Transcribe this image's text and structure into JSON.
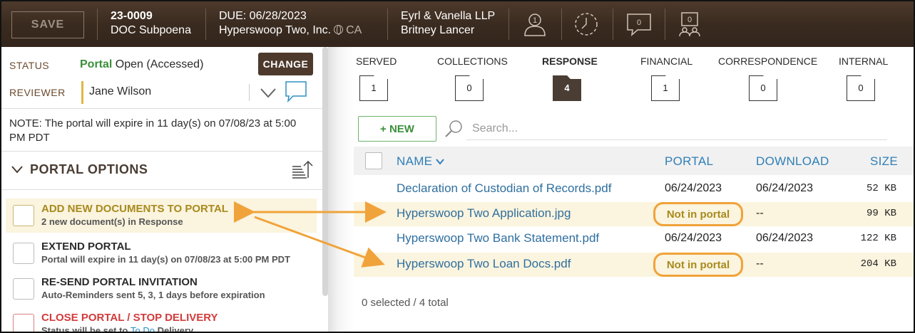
{
  "header": {
    "save_label": "SAVE",
    "case_number": "23-0009",
    "case_type": "DOC Subpoena",
    "due_label": "DUE: 06/28/2023",
    "party": "Hyperswoop Two, Inc.",
    "state": "CA",
    "firm": "Eyrl & Vanella LLP",
    "contact": "Britney Lancer",
    "icons": [
      {
        "name": "person-icon",
        "count": "1"
      },
      {
        "name": "clock-icon",
        "count": ""
      },
      {
        "name": "message-icon",
        "count": "0"
      },
      {
        "name": "people-icon",
        "count": "0"
      }
    ]
  },
  "left": {
    "status_label": "STATUS",
    "status_portal": "Portal",
    "status_text": "Open (Accessed)",
    "change_label": "CHANGE",
    "reviewer_label": "REVIEWER",
    "reviewer_value": "Jane Wilson",
    "note": "NOTE: The portal will expire in 11 day(s) on 07/08/23 at 5:00 PM PDT",
    "portal_options_title": "PORTAL OPTIONS",
    "options": [
      {
        "title": "ADD NEW DOCUMENTS TO PORTAL",
        "sub": "2 new document(s) in Response",
        "title_color": "#a88a1e",
        "highlight": true
      },
      {
        "title": "EXTEND PORTAL",
        "sub": "Portal will expire in 11 day(s) on 07/08/23 at 5:00 PM PDT",
        "title_color": "#2b2b2b",
        "highlight": false
      },
      {
        "title": "RE-SEND PORTAL INVITATION",
        "sub": "Auto-Reminders sent 5, 3, 1 days before expiration",
        "title_color": "#2b2b2b",
        "highlight": false
      },
      {
        "title": "CLOSE PORTAL / STOP DELIVERY",
        "sub_prefix": "Status will be set to",
        "sub_link": "To Do",
        "sub_suffix": "Delivery",
        "title_color": "#d23b3b",
        "highlight": false
      }
    ]
  },
  "tabs": [
    {
      "label": "SERVED",
      "count": "1",
      "active": false
    },
    {
      "label": "COLLECTIONS",
      "count": "0",
      "active": false
    },
    {
      "label": "RESPONSE",
      "count": "4",
      "active": true
    },
    {
      "label": "FINANCIAL",
      "count": "1",
      "active": false
    },
    {
      "label": "CORRESPONDENCE",
      "count": "0",
      "active": false
    },
    {
      "label": "INTERNAL",
      "count": "0",
      "active": false
    }
  ],
  "toolbar": {
    "new_label": "+ NEW",
    "search_placeholder": "Search..."
  },
  "table": {
    "columns": {
      "name": "NAME",
      "portal": "PORTAL",
      "download": "DOWNLOAD",
      "size": "SIZE"
    },
    "rows": [
      {
        "name": "Declaration of Custodian of Records.pdf",
        "portal": "06/24/2023",
        "download": "06/24/2023",
        "size": "52 KB",
        "not_in_portal": false
      },
      {
        "name": "Hyperswoop Two Application.jpg",
        "portal": "Not in portal",
        "download": "--",
        "size": "99 KB",
        "not_in_portal": true
      },
      {
        "name": "Hyperswoop Two Bank Statement.pdf",
        "portal": "06/24/2023",
        "download": "06/24/2023",
        "size": "122 KB",
        "not_in_portal": false
      },
      {
        "name": "Hyperswoop Two Loan Docs.pdf",
        "portal": "Not in portal",
        "download": "--",
        "size": "204 KB",
        "not_in_portal": true
      }
    ],
    "footer": "0 selected / 4 total"
  },
  "colors": {
    "header_bg": "#3a2b20",
    "accent_orange": "#f0a33a",
    "link_blue": "#2f6f9f",
    "green": "#3b8f3b",
    "highlight_row": "#fbf4de",
    "danger": "#d23b3b"
  }
}
